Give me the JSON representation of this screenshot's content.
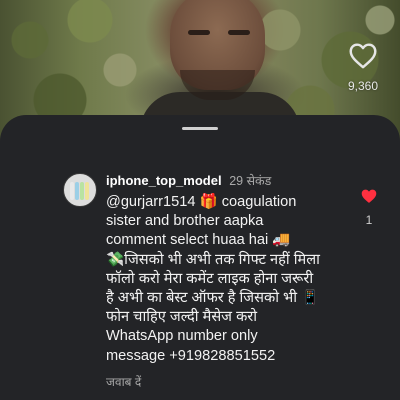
{
  "video": {
    "like_count": "9,360",
    "like_icon": "heart-outline-icon"
  },
  "comment": {
    "username": "iphone_top_model",
    "time": "29 सेकंड",
    "text": "@gurjarr1514 🎁 coagulation\nsister and brother aapka\ncomment select huaa hai 🚚\n💸जिसको भी अभी तक गिफ्ट नहीं मिला\nफॉलो करो  मेरा कमेंट लाइक होना जरूरी\nहै अभी का बेस्ट ऑफर है जिसको भी 📱\nफोन चाहिए जल्दी मैसेज करो\nWhatsApp number only\nmessage +919828851552",
    "reply_label": "जवाब दें",
    "like_count": "1",
    "like_icon": "heart-filled-icon",
    "like_color": "#ff3040"
  }
}
